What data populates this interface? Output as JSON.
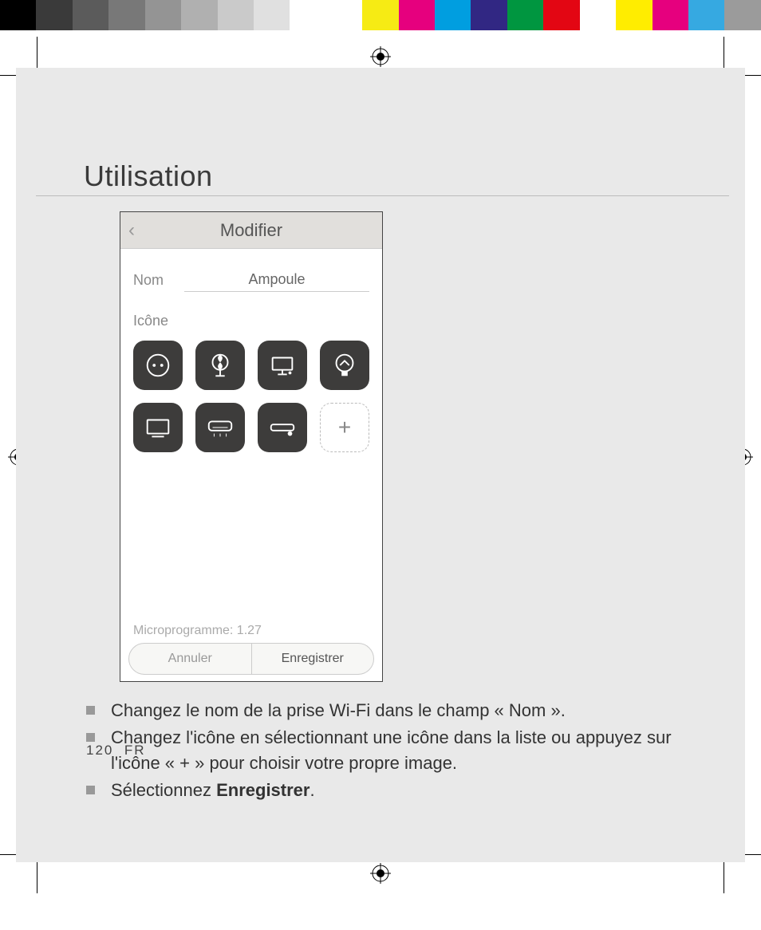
{
  "colorbar": [
    "#000000",
    "#3a3a3a",
    "#5b5b5b",
    "#787878",
    "#949494",
    "#b0b0b0",
    "#cacaca",
    "#e0e0e0",
    "#ffffff",
    "#ffffff",
    "#f6eb14",
    "#e6007e",
    "#009ee0",
    "#312783",
    "#009640",
    "#e30613",
    "#ffffff",
    "#ffed00",
    "#e6007e",
    "#36a9e1",
    "#9b9b9b"
  ],
  "heading": "Utilisation",
  "phone": {
    "title": "Modifier",
    "name_label": "Nom",
    "name_value": "Ampoule",
    "icon_label": "Icône",
    "icons": [
      "socket",
      "fan",
      "monitor",
      "bulb",
      "tv",
      "aircon",
      "soundbar",
      "add"
    ],
    "firmware_label": "Microprogramme:  1.27",
    "cancel": "Annuler",
    "save": "Enregistrer"
  },
  "bullets": [
    {
      "text": "Changez le nom de la prise Wi-Fi dans le champ « Nom »."
    },
    {
      "text": "Changez l'icône en sélectionnant une icône dans la liste ou appuyez sur l'icône « + » pour choisir votre propre image."
    },
    {
      "prefix": "Sélectionnez ",
      "bold": "Enregistrer",
      "suffix": "."
    }
  ],
  "page_number": "120",
  "page_lang": "FR"
}
